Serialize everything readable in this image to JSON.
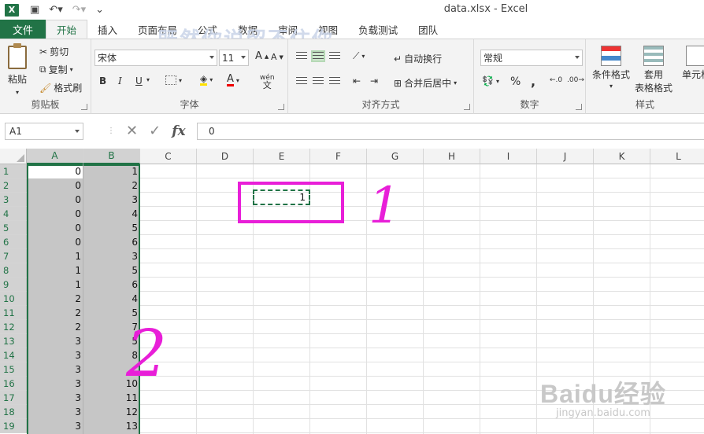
{
  "app": {
    "title": "data.xlsx - Excel",
    "logo_letter": "X",
    "watermark_text": "既然你说留不住你"
  },
  "tabs": {
    "file": "文件",
    "items": [
      "开始",
      "插入",
      "页面布局",
      "公式",
      "数据",
      "审阅",
      "视图",
      "负载测试",
      "团队"
    ],
    "active": "开始"
  },
  "ribbon": {
    "clipboard": {
      "label": "剪贴板",
      "paste": "粘贴",
      "cut": "剪切",
      "copy": "复制",
      "format_painter": "格式刷"
    },
    "font": {
      "label": "字体",
      "name": "宋体",
      "size": "11",
      "bold": "B",
      "italic": "I",
      "underline": "U",
      "phonetic": "wén"
    },
    "alignment": {
      "label": "对齐方式",
      "wrap": "自动换行",
      "merge": "合并后居中"
    },
    "number": {
      "label": "数字",
      "format": "常规",
      "percent": "%",
      "comma": ","
    },
    "styles": {
      "label": "样式",
      "conditional": "条件格式",
      "table_format_1": "套用",
      "table_format_2": "表格格式",
      "cell_styles": "单元格"
    }
  },
  "formula_bar": {
    "name_box": "A1",
    "fx": "fx",
    "content": "0"
  },
  "grid": {
    "columns": [
      "A",
      "B",
      "C",
      "D",
      "E",
      "F",
      "G",
      "H",
      "I",
      "J",
      "K",
      "L"
    ],
    "rows": [
      "1",
      "2",
      "3",
      "4",
      "5",
      "6",
      "7",
      "8",
      "9",
      "10",
      "11",
      "12",
      "13",
      "14",
      "15",
      "16",
      "17",
      "18",
      "19"
    ],
    "col_a": [
      "0",
      "0",
      "0",
      "0",
      "0",
      "0",
      "1",
      "1",
      "1",
      "2",
      "2",
      "2",
      "3",
      "3",
      "3",
      "3",
      "3",
      "3",
      "3"
    ],
    "col_b": [
      "1",
      "2",
      "3",
      "4",
      "5",
      "6",
      "3",
      "5",
      "6",
      "4",
      "5",
      "7",
      "5",
      "8",
      "",
      "10",
      "11",
      "12",
      "13"
    ],
    "copied_cell_value": "1"
  },
  "annotations": {
    "label_1": "1",
    "label_2": "2",
    "color": "#e81fd8"
  },
  "watermark": {
    "brand": "Baidu经验",
    "url": "jingyan.baidu.com"
  },
  "colors": {
    "excel_green": "#217346",
    "ribbon_bg": "#f3f3f3",
    "selection": "#c6c6c6"
  }
}
